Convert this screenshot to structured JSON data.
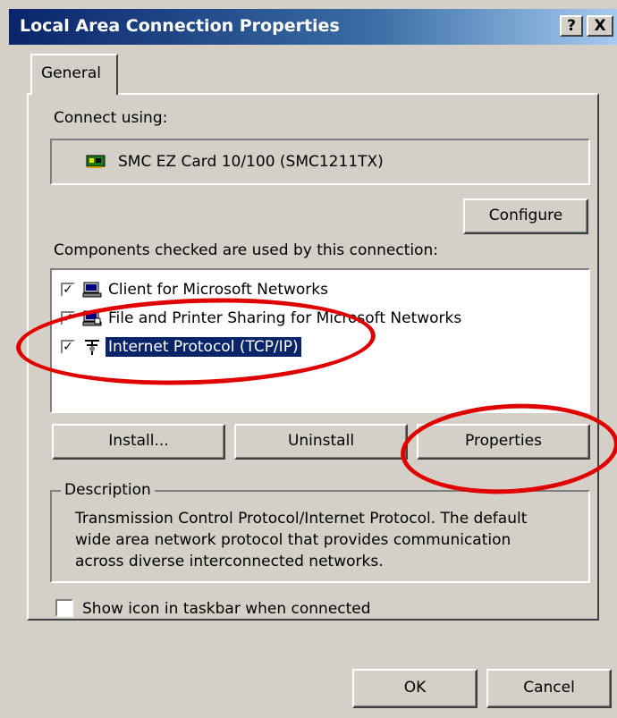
{
  "window": {
    "title": "Local Area Connection Properties",
    "help_glyph": "?",
    "close_glyph": "X"
  },
  "tabs": [
    {
      "label": "General",
      "selected": true
    }
  ],
  "connect_using": {
    "label": "Connect using:",
    "adapter_name": "SMC EZ Card 10/100 (SMC1211TX)",
    "adapter_icon": "network-card-icon",
    "configure_label": "Configure"
  },
  "components": {
    "label": "Components checked are used by this connection:",
    "items": [
      {
        "label": "Client for Microsoft Networks",
        "checked": true,
        "icon": "client-network-icon",
        "selected": false
      },
      {
        "label": "File and Printer Sharing for Microsoft Networks",
        "checked": true,
        "icon": "file-printer-sharing-icon",
        "selected": false
      },
      {
        "label": "Internet Protocol (TCP/IP)",
        "checked": true,
        "icon": "protocol-icon",
        "selected": true
      }
    ],
    "check_glyph": "✓"
  },
  "actions": {
    "install_label": "Install...",
    "uninstall_label": "Uninstall",
    "properties_label": "Properties"
  },
  "description": {
    "group_title": "Description",
    "text": "Transmission Control Protocol/Internet Protocol. The default wide area network protocol that provides communication across diverse interconnected networks."
  },
  "show_icon": {
    "label": "Show icon in taskbar when connected",
    "checked": false
  },
  "footer": {
    "ok_label": "OK",
    "cancel_label": "Cancel"
  },
  "annotations": {
    "color": "#e00000"
  }
}
